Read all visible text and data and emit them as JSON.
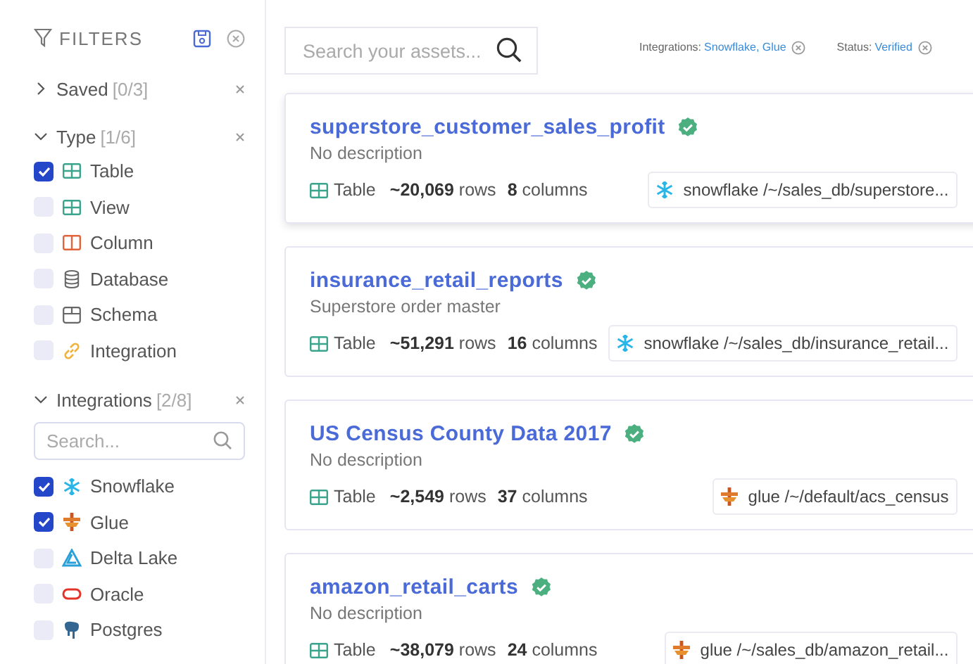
{
  "filters": {
    "title": "FILTERS",
    "sections": [
      {
        "label": "Saved",
        "count": "[0/3]",
        "expanded": false
      },
      {
        "label": "Type",
        "count": "[1/6]",
        "expanded": true,
        "items": [
          {
            "kind": "table",
            "label": "Table",
            "checked": true
          },
          {
            "kind": "view",
            "label": "View",
            "checked": false
          },
          {
            "kind": "column",
            "label": "Column",
            "checked": false
          },
          {
            "kind": "database",
            "label": "Database",
            "checked": false
          },
          {
            "kind": "schema",
            "label": "Schema",
            "checked": false
          },
          {
            "kind": "integration",
            "label": "Integration",
            "checked": false
          }
        ]
      },
      {
        "label": "Integrations",
        "count": "[2/8]",
        "expanded": true,
        "search": {
          "placeholder": "Search..."
        },
        "items": [
          {
            "kind": "snowflake",
            "label": "Snowflake",
            "checked": true
          },
          {
            "kind": "glue",
            "label": "Glue",
            "checked": true
          },
          {
            "kind": "deltalake",
            "label": "Delta Lake",
            "checked": false
          },
          {
            "kind": "oracle",
            "label": "Oracle",
            "checked": false
          },
          {
            "kind": "postgres",
            "label": "Postgres",
            "checked": false
          }
        ]
      }
    ]
  },
  "search": {
    "placeholder": "Search your assets..."
  },
  "active_filters": [
    {
      "label": "Integrations:",
      "value": "Snowflake, Glue"
    },
    {
      "label": "Status:",
      "value": "Verified"
    }
  ],
  "results": [
    {
      "title": "superstore_customer_sales_profit",
      "verified": true,
      "highlighted": true,
      "description": "No description",
      "type": "Table",
      "rows": "~20,069",
      "rows_label": "rows",
      "columns": "8",
      "columns_label": "columns",
      "source": {
        "kind": "snowflake",
        "path": "snowflake /~/sales_db/superstore..."
      }
    },
    {
      "title": "insurance_retail_reports",
      "verified": true,
      "highlighted": false,
      "description": "Superstore order master",
      "type": "Table",
      "rows": "~51,291",
      "rows_label": "rows",
      "columns": "16",
      "columns_label": "columns",
      "source": {
        "kind": "snowflake",
        "path": "snowflake /~/sales_db/insurance_retail..."
      }
    },
    {
      "title": "US Census County Data 2017",
      "verified": true,
      "highlighted": false,
      "description": "No description",
      "type": "Table",
      "rows": "~2,549",
      "rows_label": "rows",
      "columns": "37",
      "columns_label": "columns",
      "source": {
        "kind": "glue",
        "path": "glue /~/default/acs_census"
      }
    },
    {
      "title": "amazon_retail_carts",
      "verified": true,
      "highlighted": false,
      "description": "No description",
      "type": "Table",
      "rows": "~38,079",
      "rows_label": "rows",
      "columns": "24",
      "columns_label": "columns",
      "source": {
        "kind": "glue",
        "path": "glue /~/sales_db/amazon_retail..."
      }
    }
  ]
}
